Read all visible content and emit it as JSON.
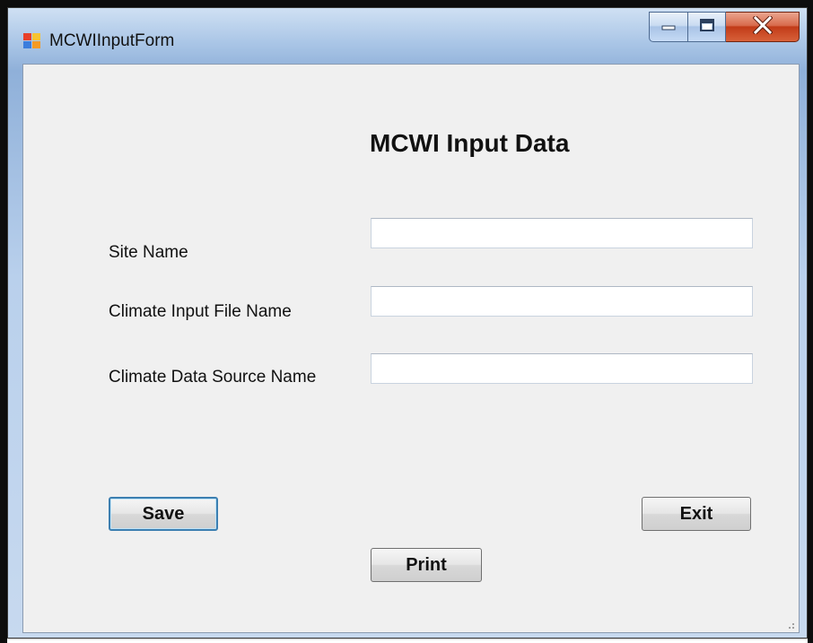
{
  "window": {
    "title": "MCWIInputForm",
    "app_icon": "windows-form-icon",
    "caption_buttons": {
      "minimize_icon": "minimize-icon",
      "maximize_icon": "maximize-icon",
      "close_icon": "close-icon"
    }
  },
  "form": {
    "heading": "MCWI Input Data",
    "fields": [
      {
        "label": "Site Name",
        "value": ""
      },
      {
        "label": "Climate Input File Name",
        "value": ""
      },
      {
        "label": "Climate Data Source Name",
        "value": ""
      }
    ],
    "buttons": {
      "save": "Save",
      "exit": "Exit",
      "print": "Print"
    }
  },
  "colors": {
    "titlebar_blue": "#a9c5e6",
    "client_background": "#f0f0f0",
    "close_button_red": "#c13b18",
    "default_button_border": "#3c7fb1"
  }
}
